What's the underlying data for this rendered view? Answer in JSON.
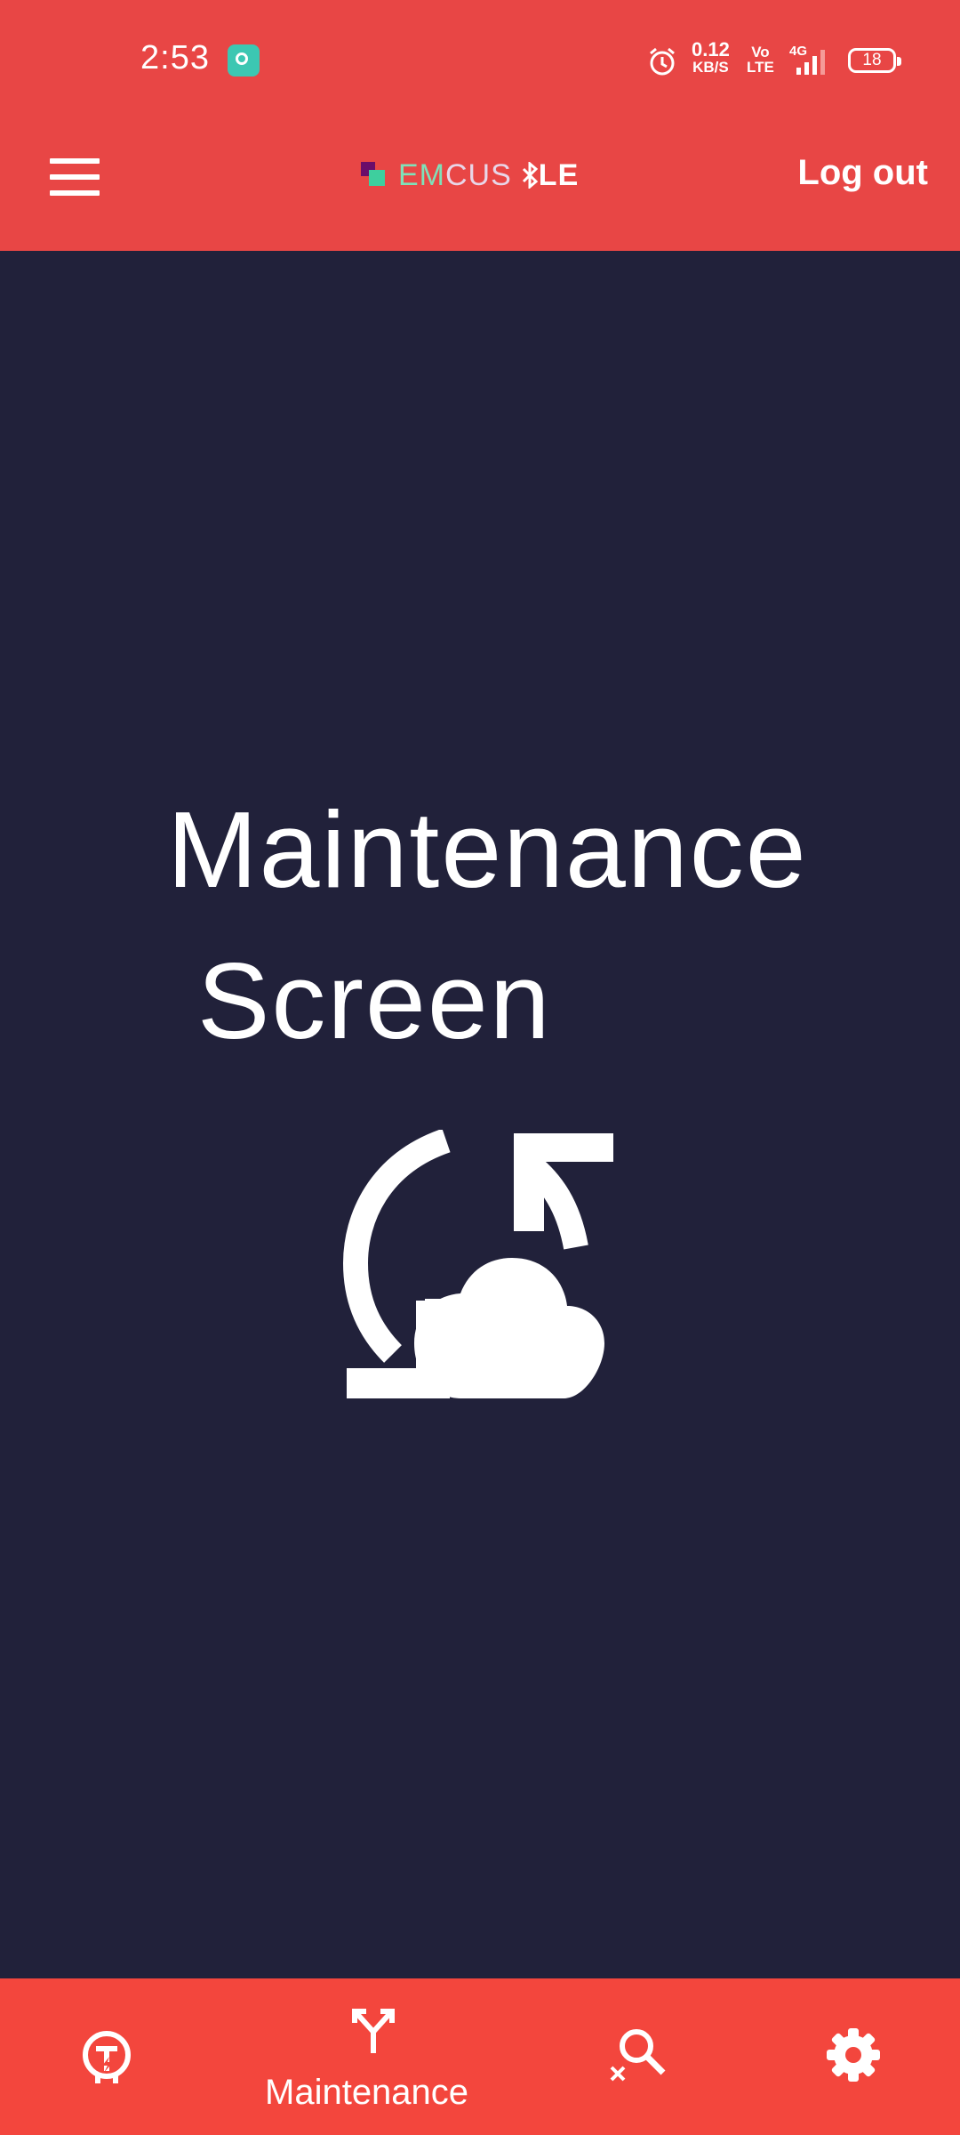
{
  "status_bar": {
    "time": "2:53",
    "net_speed_value": "0.12",
    "net_speed_unit": "KB/S",
    "volte_top": "Vo",
    "volte_bottom": "LTE",
    "network_type": "4G",
    "battery_level": "18"
  },
  "header": {
    "logo_em": "EM",
    "logo_cus": "CUS",
    "logo_ble": "LE",
    "logout_label": "Log out"
  },
  "main": {
    "title_line1": "Maintenance",
    "title_line2": "Screen",
    "hero_icon": "sync-cloud-icon"
  },
  "bottom_nav": {
    "items": [
      {
        "icon": "firmware-update-icon",
        "label": ""
      },
      {
        "icon": "fork-arrows-icon",
        "label": "Maintenance"
      },
      {
        "icon": "search-clear-icon",
        "label": ""
      },
      {
        "icon": "gear-icon",
        "label": ""
      }
    ]
  },
  "colors": {
    "header_bg": "#e84645",
    "body_bg": "#21213a",
    "nav_bg": "#f3463d",
    "logo_green": "#3ecf9e",
    "logo_purple": "#6a0d6a"
  }
}
